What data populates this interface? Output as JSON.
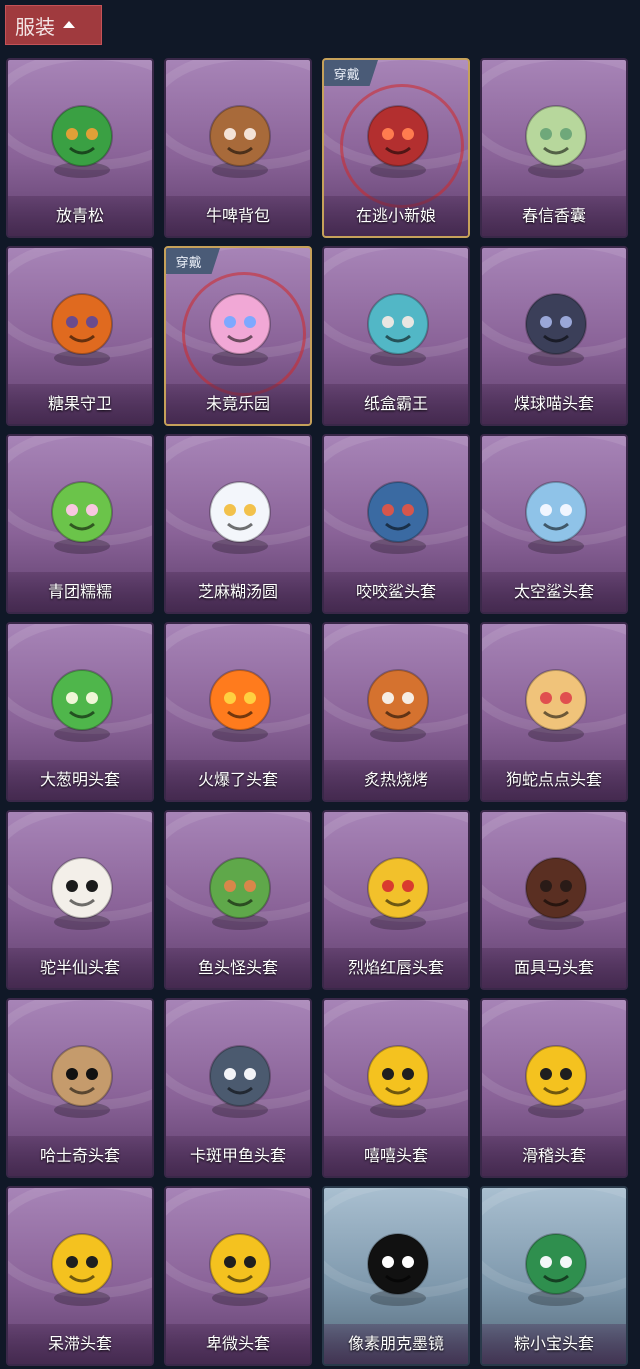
{
  "header": {
    "title": "服装"
  },
  "badge": "穿戴",
  "items": [
    {
      "label": "放青松",
      "icon": "bonsai-icon",
      "theme": "purple",
      "worn": false,
      "c1": "#3aa043",
      "c2": "#e0a037"
    },
    {
      "label": "牛啤背包",
      "icon": "beer-barrel-cow-icon",
      "theme": "purple",
      "worn": false,
      "c1": "#a86a3a",
      "c2": "#f3e2d6"
    },
    {
      "label": "在逃小新娘",
      "icon": "red-umbrella-bride-icon",
      "theme": "purple",
      "worn": true,
      "c1": "#b32f2f",
      "c2": "#ff7c4f"
    },
    {
      "label": "春信香囊",
      "icon": "sachet-icon",
      "theme": "purple",
      "worn": false,
      "c1": "#b7d79c",
      "c2": "#6fa87a"
    },
    {
      "label": "糖果守卫",
      "icon": "pumpkin-scarecrow-icon",
      "theme": "purple",
      "worn": false,
      "c1": "#e06a1f",
      "c2": "#6b4b8c"
    },
    {
      "label": "未竟乐园",
      "icon": "fairy-girl-icon",
      "theme": "purple",
      "worn": true,
      "c1": "#f1a8d6",
      "c2": "#7ea8ff"
    },
    {
      "label": "纸盒霸王",
      "icon": "box-dinosaur-icon",
      "theme": "purple",
      "worn": false,
      "c1": "#52b7c6",
      "c2": "#e9e6e2"
    },
    {
      "label": "煤球喵头套",
      "icon": "black-cat-head-icon",
      "theme": "purple",
      "worn": false,
      "c1": "#3b3f59",
      "c2": "#9aa7d8"
    },
    {
      "label": "青团糯糯",
      "icon": "green-dumpling-icon",
      "theme": "purple",
      "worn": false,
      "c1": "#6bc44a",
      "c2": "#f8c7e0"
    },
    {
      "label": "芝麻糊汤圆",
      "icon": "white-dumpling-icon",
      "theme": "purple",
      "worn": false,
      "c1": "#f3f6fb",
      "c2": "#f2c14b"
    },
    {
      "label": "咬咬鲨头套",
      "icon": "shark-head-icon",
      "theme": "purple",
      "worn": false,
      "c1": "#3a6aa2",
      "c2": "#d6564c"
    },
    {
      "label": "太空鲨头套",
      "icon": "space-shark-icon",
      "theme": "purple",
      "worn": false,
      "c1": "#8fc3e8",
      "c2": "#f1f6ff"
    },
    {
      "label": "大葱明头套",
      "icon": "scallion-head-icon",
      "theme": "purple",
      "worn": false,
      "c1": "#4fb64b",
      "c2": "#f1f6d8"
    },
    {
      "label": "火爆了头套",
      "icon": "fire-head-icon",
      "theme": "purple",
      "worn": false,
      "c1": "#ff7b1d",
      "c2": "#ffd040"
    },
    {
      "label": "炙热烧烤",
      "icon": "bbq-meat-icon",
      "theme": "purple",
      "worn": false,
      "c1": "#d5722f",
      "c2": "#f6ede4"
    },
    {
      "label": "狗蛇点点头套",
      "icon": "snake-head-icon",
      "theme": "purple",
      "worn": false,
      "c1": "#f0c37a",
      "c2": "#e04f4f"
    },
    {
      "label": "驼半仙头套",
      "icon": "alpaca-sunglasses-icon",
      "theme": "purple",
      "worn": false,
      "c1": "#f3efe9",
      "c2": "#1b1b1b"
    },
    {
      "label": "鱼头怪头套",
      "icon": "fish-head-icon",
      "theme": "purple",
      "worn": false,
      "c1": "#5fa84a",
      "c2": "#d9874a"
    },
    {
      "label": "烈焰红唇头套",
      "icon": "yellow-mask-icon",
      "theme": "purple",
      "worn": false,
      "c1": "#f2c12b",
      "c2": "#d93b2f"
    },
    {
      "label": "面具马头套",
      "icon": "horse-head-icon",
      "theme": "purple",
      "worn": false,
      "c1": "#5a2f22",
      "c2": "#2a1b17"
    },
    {
      "label": "哈士奇头套",
      "icon": "dog-sunglasses-icon",
      "theme": "purple",
      "worn": false,
      "c1": "#c59b6c",
      "c2": "#111111"
    },
    {
      "label": "卡斑甲鱼头套",
      "icon": "turtle-head-icon",
      "theme": "purple",
      "worn": false,
      "c1": "#4b5a6f",
      "c2": "#f2f3f7"
    },
    {
      "label": "嘻嘻头套",
      "icon": "grin-emoji-icon",
      "theme": "purple",
      "worn": false,
      "c1": "#f4c21f",
      "c2": "#1f1f1f"
    },
    {
      "label": "滑稽头套",
      "icon": "smirk-emoji-icon",
      "theme": "purple",
      "worn": false,
      "c1": "#f4c21f",
      "c2": "#1f1f1f"
    },
    {
      "label": "呆滞头套",
      "icon": "dazed-emoji-icon",
      "theme": "purple",
      "worn": false,
      "c1": "#f4c21f",
      "c2": "#1f1f1f"
    },
    {
      "label": "卑微头套",
      "icon": "humble-emoji-icon",
      "theme": "purple",
      "worn": false,
      "c1": "#f4c21f",
      "c2": "#1f1f1f"
    },
    {
      "label": "像素朋克墨镜",
      "icon": "pixel-sunglasses-icon",
      "theme": "blue",
      "worn": false,
      "c1": "#111111",
      "c2": "#ffffff"
    },
    {
      "label": "粽小宝头套",
      "icon": "zongzi-head-icon",
      "theme": "blue",
      "worn": false,
      "c1": "#2f8f4e",
      "c2": "#f4f6f8"
    }
  ]
}
